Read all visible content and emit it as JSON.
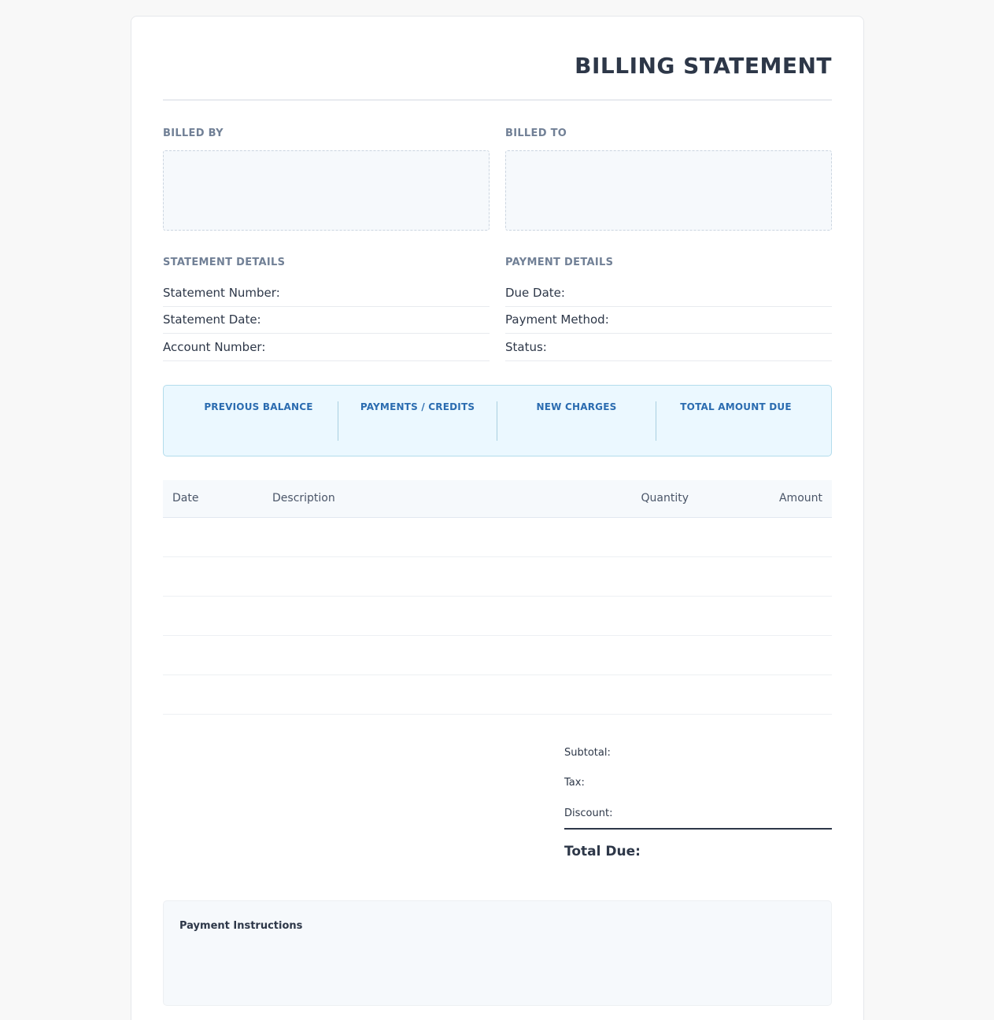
{
  "document": {
    "title": "BILLING STATEMENT"
  },
  "parties": {
    "billed_by_label": "BILLED BY",
    "billed_to_label": "BILLED TO"
  },
  "statement_details": {
    "heading": "STATEMENT DETAILS",
    "rows": [
      "Statement Number:",
      "Statement Date:",
      "Account Number:"
    ]
  },
  "payment_details": {
    "heading": "PAYMENT DETAILS",
    "rows": [
      "Due Date:",
      "Payment Method:",
      "Status:"
    ]
  },
  "summary": {
    "cells": [
      "PREVIOUS BALANCE",
      "PAYMENTS / CREDITS",
      "NEW CHARGES",
      "TOTAL AMOUNT DUE"
    ]
  },
  "table": {
    "headers": {
      "date": "Date",
      "description": "Description",
      "quantity": "Quantity",
      "amount": "Amount"
    }
  },
  "totals": {
    "subtotal": "Subtotal:",
    "tax": "Tax:",
    "discount": "Discount:",
    "total_due": "Total Due:"
  },
  "instructions": {
    "title": "Payment Instructions"
  },
  "colors": {
    "accent": "#2b6cb0",
    "text": "#2d3748",
    "muted": "#718096",
    "summary_bg": "#ebf8ff"
  }
}
